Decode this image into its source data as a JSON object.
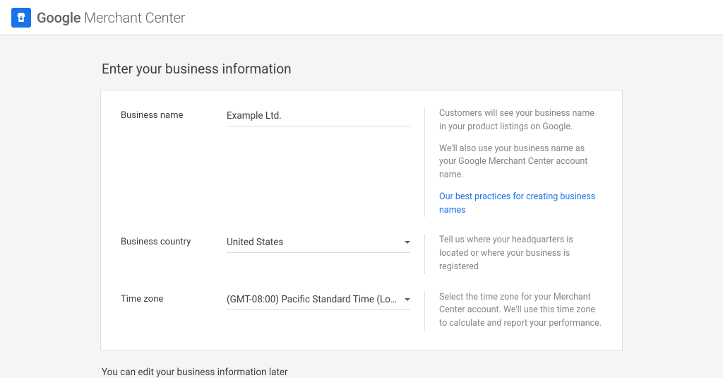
{
  "header": {
    "logo_google": "Google",
    "logo_product": " Merchant Center"
  },
  "page": {
    "title": "Enter your business information",
    "footer_note": "You can edit your business information later"
  },
  "fields": {
    "business_name": {
      "label": "Business name",
      "value": "Example Ltd.",
      "help1": "Customers will see your business name in your product listings on Google.",
      "help2": "We'll also use your business name as your Google Merchant Center account name.",
      "help_link": "Our best practices for creating business names"
    },
    "business_country": {
      "label": "Business country",
      "value": "United States",
      "help": "Tell us where your headquarters is located or where your business is registered"
    },
    "time_zone": {
      "label": "Time zone",
      "value": "(GMT-08:00) Pacific Standard Time (Lo…",
      "help": "Select the time zone for your Merchant Center account. We'll use this time zone to calculate and report your performance."
    }
  }
}
